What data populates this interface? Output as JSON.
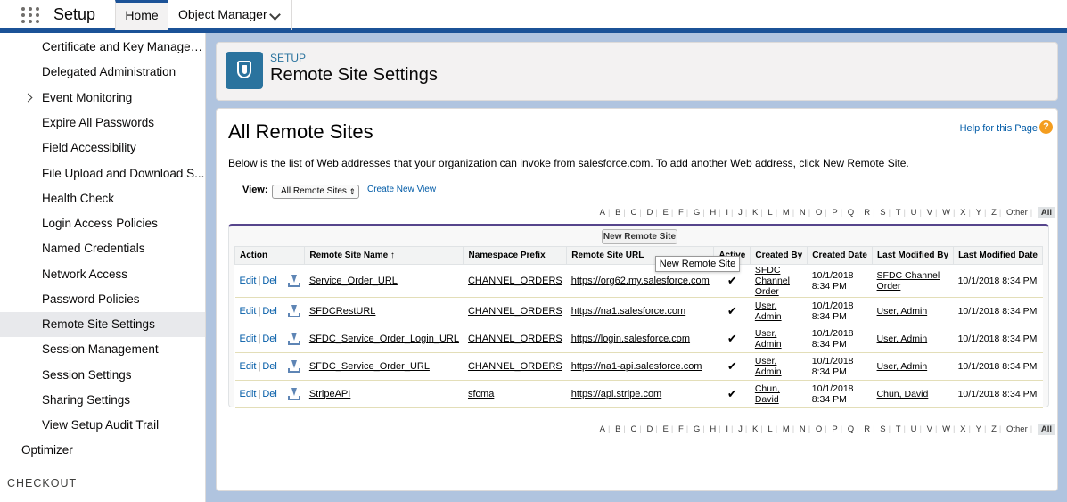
{
  "topbar": {
    "app_title": "Setup",
    "tabs": [
      {
        "label": "Home"
      },
      {
        "label": "Object Manager"
      }
    ]
  },
  "sidebar": {
    "items": [
      {
        "label": "Certificate and Key Managem..."
      },
      {
        "label": "Delegated Administration"
      },
      {
        "label": "Event Monitoring"
      },
      {
        "label": "Expire All Passwords"
      },
      {
        "label": "Field Accessibility"
      },
      {
        "label": "File Upload and Download S..."
      },
      {
        "label": "Health Check"
      },
      {
        "label": "Login Access Policies"
      },
      {
        "label": "Named Credentials"
      },
      {
        "label": "Network Access"
      },
      {
        "label": "Password Policies"
      },
      {
        "label": "Remote Site Settings"
      },
      {
        "label": "Session Management"
      },
      {
        "label": "Session Settings"
      },
      {
        "label": "Sharing Settings"
      },
      {
        "label": "View Setup Audit Trail"
      }
    ],
    "optimizer": "Optimizer",
    "section": "CHECKOUT"
  },
  "header": {
    "eyebrow": "SETUP",
    "title": "Remote Site Settings"
  },
  "content": {
    "heading": "All Remote Sites",
    "help_link": "Help for this Page",
    "help_icon": "?",
    "description": "Below is the list of Web addresses that your organization can invoke from salesforce.com. To add another Web address, click New Remote Site.",
    "view_label": "View:",
    "view_value": "All Remote Sites",
    "create_view": "Create New View",
    "new_button": "New Remote Site",
    "tooltip": "New Remote Site",
    "alpha": [
      "A",
      "B",
      "C",
      "D",
      "E",
      "F",
      "G",
      "H",
      "I",
      "J",
      "K",
      "L",
      "M",
      "N",
      "O",
      "P",
      "Q",
      "R",
      "S",
      "T",
      "U",
      "V",
      "W",
      "X",
      "Y",
      "Z",
      "Other",
      "All"
    ]
  },
  "table": {
    "headers": [
      "Action",
      "Remote Site Name ↑",
      "Namespace Prefix",
      "Remote Site URL",
      "Active",
      "Created By",
      "Created Date",
      "Last Modified By",
      "Last Modified Date"
    ],
    "edit": "Edit",
    "del": "Del",
    "rows": [
      {
        "name": "Service_Order_URL",
        "ns": "CHANNEL_ORDERS",
        "url": "https://org62.my.salesforce.com",
        "active": "✔",
        "created_by": "SFDC Channel Order",
        "created_date": "10/1/2018 8:34 PM",
        "modified_by": "SFDC Channel Order",
        "modified_date": "10/1/2018 8:34 PM"
      },
      {
        "name": "SFDCRestURL",
        "ns": "CHANNEL_ORDERS",
        "url": "https://na1.salesforce.com",
        "active": "✔",
        "created_by": "User, Admin",
        "created_date": "10/1/2018 8:34 PM",
        "modified_by": "User, Admin",
        "modified_date": "10/1/2018 8:34 PM"
      },
      {
        "name": "SFDC_Service_Order_Login_URL",
        "ns": "CHANNEL_ORDERS",
        "url": "https://login.salesforce.com",
        "active": "✔",
        "created_by": "User, Admin",
        "created_date": "10/1/2018 8:34 PM",
        "modified_by": "User, Admin",
        "modified_date": "10/1/2018 8:34 PM"
      },
      {
        "name": "SFDC_Service_Order_URL",
        "ns": "CHANNEL_ORDERS",
        "url": "https://na1-api.salesforce.com",
        "active": "✔",
        "created_by": "User, Admin",
        "created_date": "10/1/2018 8:34 PM",
        "modified_by": "User, Admin",
        "modified_date": "10/1/2018 8:34 PM"
      },
      {
        "name": "StripeAPI",
        "ns": "sfcma",
        "url": "https://api.stripe.com",
        "active": "✔",
        "created_by": "Chun, David",
        "created_date": "10/1/2018 8:34 PM",
        "modified_by": "Chun, David",
        "modified_date": "10/1/2018 8:34 PM"
      }
    ]
  }
}
